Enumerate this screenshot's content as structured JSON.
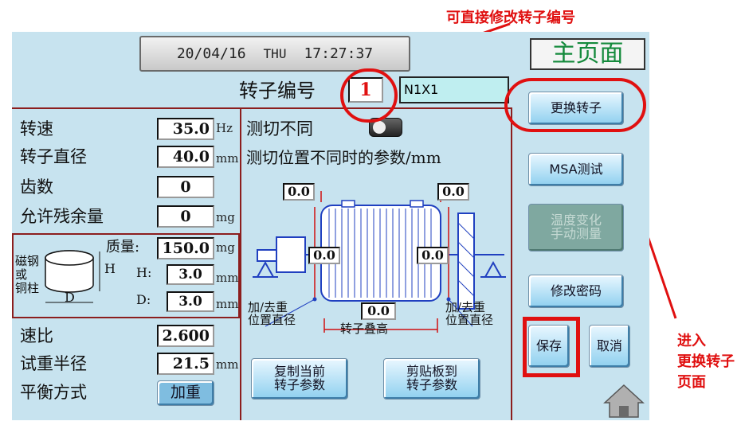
{
  "annotations": {
    "top_note": "可直接修改转子编号",
    "side_note_1": "进入",
    "side_note_2": "更换转子",
    "side_note_3": "页面"
  },
  "header": {
    "date": "20/04/16",
    "weekday": "THU",
    "time": "17:27:37",
    "page_title": "主页面"
  },
  "rotor": {
    "label": "转子编号",
    "number": "1",
    "name": "N1X1"
  },
  "left_params": {
    "speed": {
      "label": "转速",
      "value": "35.0",
      "unit": "Hz"
    },
    "diameter": {
      "label": "转子直径",
      "value": "40.0",
      "unit": "mm"
    },
    "teeth": {
      "label": "齿数",
      "value": "0"
    },
    "residual": {
      "label": "允许残余量",
      "value": "0",
      "unit": "mg"
    },
    "magnet": {
      "label_1": "磁钢",
      "label_2": "或",
      "label_3": "铜柱",
      "h_tag": "H",
      "d_tag": "D",
      "mass": {
        "label": "质量:",
        "value": "150.0",
        "unit": "mg"
      },
      "h": {
        "label": "H:",
        "value": "3.0",
        "unit": "mm"
      },
      "d": {
        "label": "D:",
        "value": "3.0",
        "unit": "mm"
      }
    },
    "ratio": {
      "label": "速比",
      "value": "2.600"
    },
    "test_radius": {
      "label": "试重半径",
      "value": "21.5",
      "unit": "mm"
    },
    "balance_mode": {
      "label": "平衡方式",
      "value": "加重"
    }
  },
  "center": {
    "diff_label": "测切不同",
    "diff_params_label": "测切位置不同时的参数/mm",
    "val_top_left": "0.0",
    "val_top_right": "0.0",
    "val_mid_left": "0.0",
    "val_mid_right": "0.0",
    "val_bottom": "0.0",
    "add_remove_left_1": "加/去重",
    "add_remove_left_2": "位置直径",
    "add_remove_right_1": "加/去重",
    "add_remove_right_2": "位置直径",
    "stack_height": "转子叠高",
    "copy_btn_1": "复制当前",
    "copy_btn_2": "转子参数",
    "paste_btn_1": "剪贴板到",
    "paste_btn_2": "转子参数"
  },
  "right": {
    "change_rotor": "更换转子",
    "msa": "MSA测试",
    "temp_1": "温度变化",
    "temp_2": "手动测量",
    "change_pwd": "修改密码",
    "save": "保存",
    "cancel": "取消"
  }
}
